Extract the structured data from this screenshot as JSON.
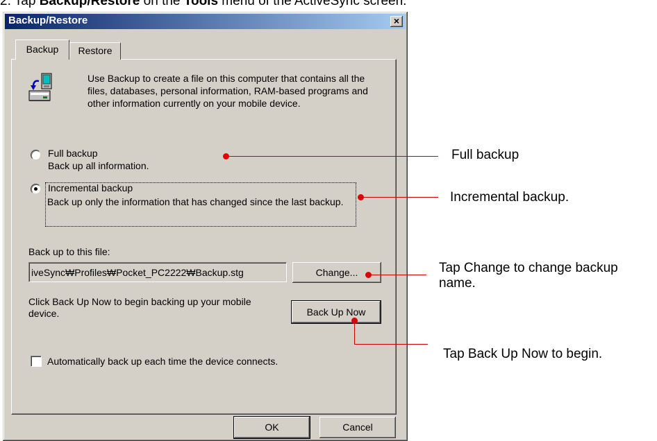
{
  "caption": {
    "prefix": "2. Tap ",
    "bold1": "Backup/Restore",
    "middle": " on the ",
    "bold2": "Tools",
    "suffix": " menu of the ActiveSync screen."
  },
  "dialog": {
    "title": "Backup/Restore",
    "close_label": "×",
    "tabs": [
      {
        "label": "Backup",
        "active": true
      },
      {
        "label": "Restore",
        "active": false
      }
    ],
    "description": "Use Backup to create a file on this computer that contains all the files, databases, personal information, RAM-based programs and other information currently on your mobile device.",
    "options": [
      {
        "title": "Full backup",
        "desc": "Back up all information.",
        "selected": false
      },
      {
        "title": "Incremental backup",
        "desc": "Back up only the information that has changed since the last backup.",
        "selected": true
      }
    ],
    "file_label": "Back up to this file:",
    "file_path": "iveSync₩Profiles₩Pocket_PC2222₩Backup.stg",
    "change_label": "Change...",
    "backup_hint": "Click Back Up Now to begin backing up your mobile device.",
    "backup_now_label": "Back Up Now",
    "auto_label": "Automatically back up each time the device connects.",
    "auto_checked": false,
    "ok_label": "OK",
    "cancel_label": "Cancel",
    "icon": "backup-device-icon"
  },
  "annotations": {
    "full": "Full backup",
    "incremental": "Incremental backup.",
    "change": "Tap Change to change backup name.",
    "backup_now": "Tap Back Up Now to begin."
  },
  "colors": {
    "annotation_line": "#cc0000",
    "titlebar_start": "#0a246a",
    "titlebar_end": "#a6caf0",
    "face": "#d4d0c8"
  }
}
